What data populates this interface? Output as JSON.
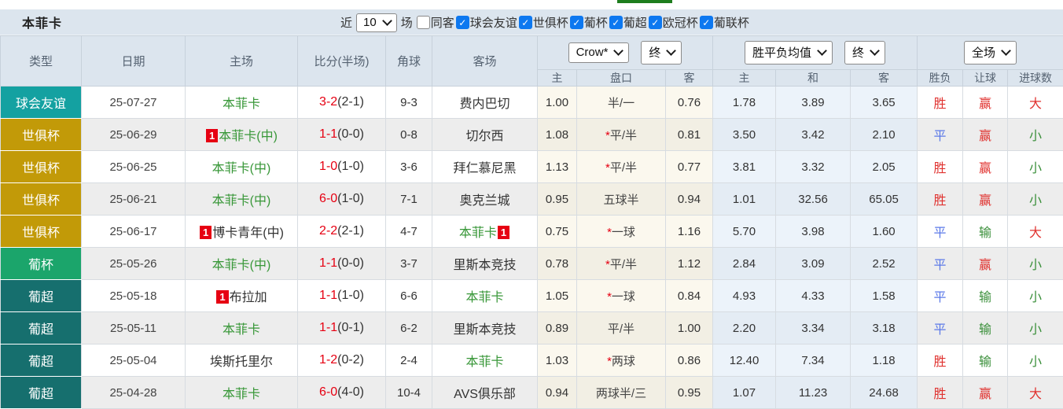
{
  "header": {
    "title": "本菲卡",
    "tab_underline_color": "#1e7d1e"
  },
  "filters": {
    "recent_prefix": "近",
    "recent_value": "10",
    "recent_suffix": "场",
    "checkboxes": [
      {
        "label": "同客",
        "checked": false
      },
      {
        "label": "球会友谊",
        "checked": true
      },
      {
        "label": "世俱杯",
        "checked": true
      },
      {
        "label": "葡杯",
        "checked": true
      },
      {
        "label": "葡超",
        "checked": true
      },
      {
        "label": "欧冠杯",
        "checked": true
      },
      {
        "label": "葡联杯",
        "checked": true
      }
    ]
  },
  "table": {
    "columns": [
      "类型",
      "日期",
      "主场",
      "比分(半场)",
      "角球",
      "客场"
    ],
    "selects": {
      "bookmaker": "Crow*",
      "bookmaker_time": "终",
      "average": "胜平负均值",
      "average_time": "终",
      "period": "全场"
    },
    "sub_columns": [
      "主",
      "盘口",
      "客",
      "主",
      "和",
      "客",
      "胜负",
      "让球",
      "进球数"
    ],
    "type_colors": {
      "球会友谊": "#14a1a1",
      "世俱杯": "#c29a08",
      "葡杯": "#1ba56b",
      "葡超": "#166f6e"
    },
    "outcome_colors": {
      "胜": "#e0312e",
      "平": "#5b79e8",
      "负": "#3a8f3a",
      "赢": "#e0312e",
      "输": "#3a8f3a",
      "大": "#e0312e",
      "小": "#3a8f3a"
    },
    "rows": [
      {
        "type": "球会友谊",
        "date": "25-07-27",
        "home": {
          "name": "本菲卡",
          "green": true
        },
        "score_ft": "3-2",
        "score_ht": "(2-1)",
        "corners": "9-3",
        "away": {
          "name": "费内巴切",
          "green": false
        },
        "crow_home": "1.00",
        "handicap": "半/一",
        "crow_away": "0.76",
        "avg": [
          "1.78",
          "3.89",
          "3.65"
        ],
        "outcome": [
          "胜",
          "赢",
          "大"
        ]
      },
      {
        "type": "世俱杯",
        "date": "25-06-29",
        "home": {
          "name": "本菲卡(中)",
          "green": true,
          "badge_before": "1"
        },
        "score_ft": "1-1",
        "score_ht": "(0-0)",
        "corners": "0-8",
        "away": {
          "name": "切尔西",
          "green": false
        },
        "crow_home": "1.08",
        "handicap": "*平/半",
        "crow_away": "0.81",
        "avg": [
          "3.50",
          "3.42",
          "2.10"
        ],
        "outcome": [
          "平",
          "赢",
          "小"
        ]
      },
      {
        "type": "世俱杯",
        "date": "25-06-25",
        "home": {
          "name": "本菲卡(中)",
          "green": true
        },
        "score_ft": "1-0",
        "score_ht": "(1-0)",
        "corners": "3-6",
        "away": {
          "name": "拜仁慕尼黑",
          "green": false
        },
        "crow_home": "1.13",
        "handicap": "*平/半",
        "crow_away": "0.77",
        "avg": [
          "3.81",
          "3.32",
          "2.05"
        ],
        "outcome": [
          "胜",
          "赢",
          "小"
        ]
      },
      {
        "type": "世俱杯",
        "date": "25-06-21",
        "home": {
          "name": "本菲卡(中)",
          "green": true
        },
        "score_ft": "6-0",
        "score_ht": "(1-0)",
        "corners": "7-1",
        "away": {
          "name": "奥克兰城",
          "green": false
        },
        "crow_home": "0.95",
        "handicap": "五球半",
        "crow_away": "0.94",
        "avg": [
          "1.01",
          "32.56",
          "65.05"
        ],
        "outcome": [
          "胜",
          "赢",
          "小"
        ]
      },
      {
        "type": "世俱杯",
        "date": "25-06-17",
        "home": {
          "name": "博卡青年(中)",
          "green": false,
          "badge_before": "1"
        },
        "score_ft": "2-2",
        "score_ht": "(2-1)",
        "corners": "4-7",
        "away": {
          "name": "本菲卡",
          "green": true,
          "badge_after": "1"
        },
        "crow_home": "0.75",
        "handicap": "*一球",
        "crow_away": "1.16",
        "avg": [
          "5.70",
          "3.98",
          "1.60"
        ],
        "outcome": [
          "平",
          "输",
          "大"
        ]
      },
      {
        "type": "葡杯",
        "date": "25-05-26",
        "home": {
          "name": "本菲卡(中)",
          "green": true
        },
        "score_ft": "1-1",
        "score_ht": "(0-0)",
        "corners": "3-7",
        "away": {
          "name": "里斯本竞技",
          "green": false
        },
        "crow_home": "0.78",
        "handicap": "*平/半",
        "crow_away": "1.12",
        "avg": [
          "2.84",
          "3.09",
          "2.52"
        ],
        "outcome": [
          "平",
          "赢",
          "小"
        ]
      },
      {
        "type": "葡超",
        "date": "25-05-18",
        "home": {
          "name": "布拉加",
          "green": false,
          "badge_before": "1"
        },
        "score_ft": "1-1",
        "score_ht": "(1-0)",
        "corners": "6-6",
        "away": {
          "name": "本菲卡",
          "green": true
        },
        "crow_home": "1.05",
        "handicap": "*一球",
        "crow_away": "0.84",
        "avg": [
          "4.93",
          "4.33",
          "1.58"
        ],
        "outcome": [
          "平",
          "输",
          "小"
        ]
      },
      {
        "type": "葡超",
        "date": "25-05-11",
        "home": {
          "name": "本菲卡",
          "green": true
        },
        "score_ft": "1-1",
        "score_ht": "(0-1)",
        "corners": "6-2",
        "away": {
          "name": "里斯本竞技",
          "green": false
        },
        "crow_home": "0.89",
        "handicap": "平/半",
        "crow_away": "1.00",
        "avg": [
          "2.20",
          "3.34",
          "3.18"
        ],
        "outcome": [
          "平",
          "输",
          "小"
        ]
      },
      {
        "type": "葡超",
        "date": "25-05-04",
        "home": {
          "name": "埃斯托里尔",
          "green": false
        },
        "score_ft": "1-2",
        "score_ht": "(0-2)",
        "corners": "2-4",
        "away": {
          "name": "本菲卡",
          "green": true
        },
        "crow_home": "1.03",
        "handicap": "*两球",
        "crow_away": "0.86",
        "avg": [
          "12.40",
          "7.34",
          "1.18"
        ],
        "outcome": [
          "胜",
          "输",
          "小"
        ]
      },
      {
        "type": "葡超",
        "date": "25-04-28",
        "home": {
          "name": "本菲卡",
          "green": true
        },
        "score_ft": "6-0",
        "score_ht": "(4-0)",
        "corners": "10-4",
        "away": {
          "name": "AVS俱乐部",
          "green": false
        },
        "crow_home": "0.94",
        "handicap": "两球半/三",
        "crow_away": "0.95",
        "avg": [
          "1.07",
          "11.23",
          "24.68"
        ],
        "outcome": [
          "胜",
          "赢",
          "大"
        ]
      }
    ]
  }
}
